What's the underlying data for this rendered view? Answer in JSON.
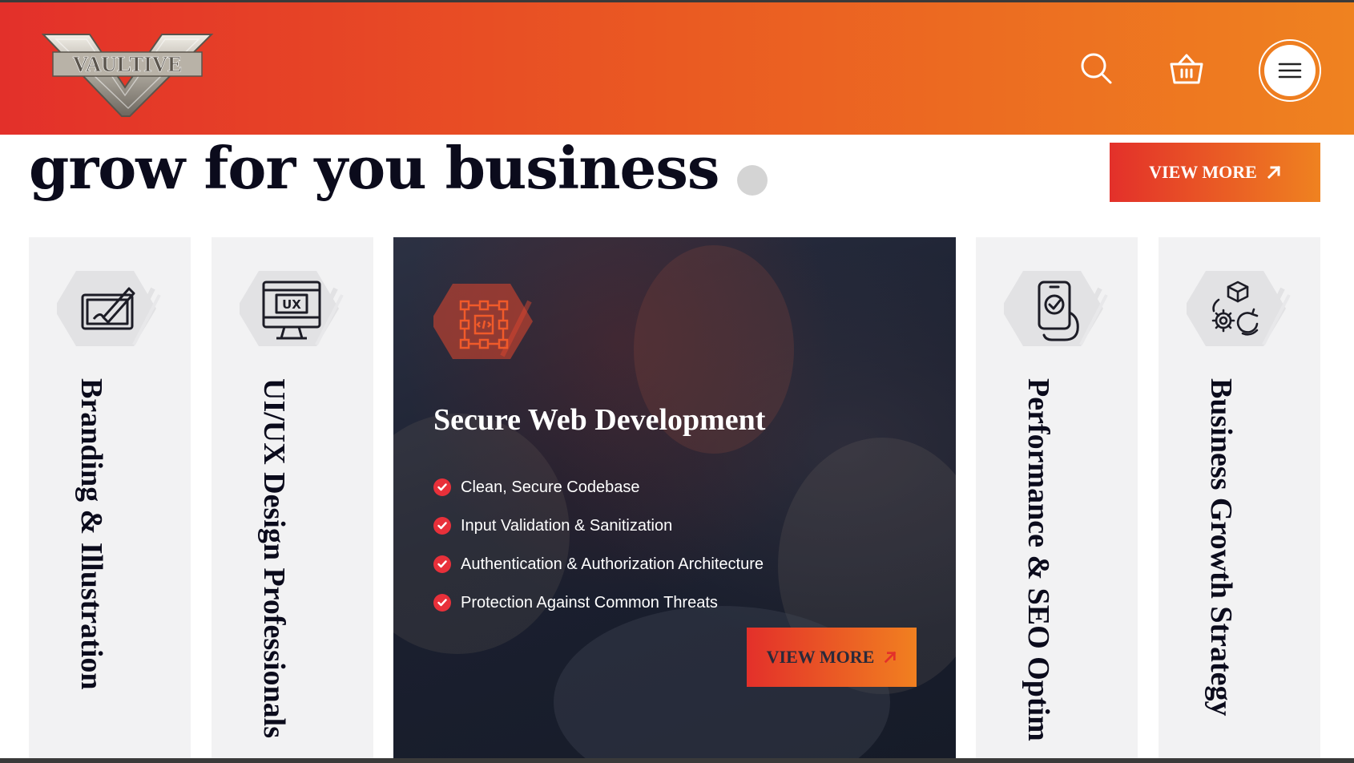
{
  "header": {
    "logo_text": "VAULTIVE",
    "icons": {
      "search": "search-icon",
      "cart": "basket-icon",
      "menu": "hamburger-icon"
    }
  },
  "section": {
    "heading": "grow for you business",
    "view_more_label": "VIEW MORE",
    "view_more_icon": "arrow-up-right-icon"
  },
  "cards": [
    {
      "title": "Branding & Illustration",
      "icon": "drawing-tablet-icon"
    },
    {
      "title": "UI/UX Design Professionals",
      "icon": "ux-monitor-icon"
    },
    {
      "title": "Performance & SEO Optim",
      "icon": "phone-check-icon"
    },
    {
      "title": "Business Growth Strategy",
      "icon": "gear-cycle-icon"
    }
  ],
  "active_card": {
    "title": "Secure Web Development",
    "icon": "code-network-icon",
    "features": [
      "Clean, Secure Codebase",
      "Input Validation & Sanitization",
      "Authentication & Authorization Architecture",
      "Protection Against Common Threats"
    ],
    "view_more_label": "VIEW MORE"
  },
  "colors": {
    "gradient_start": "#e3302a",
    "gradient_end": "#ef8220",
    "heading": "#0b0b1c",
    "card_bg": "#f2f2f3",
    "check": "#e8303a"
  }
}
